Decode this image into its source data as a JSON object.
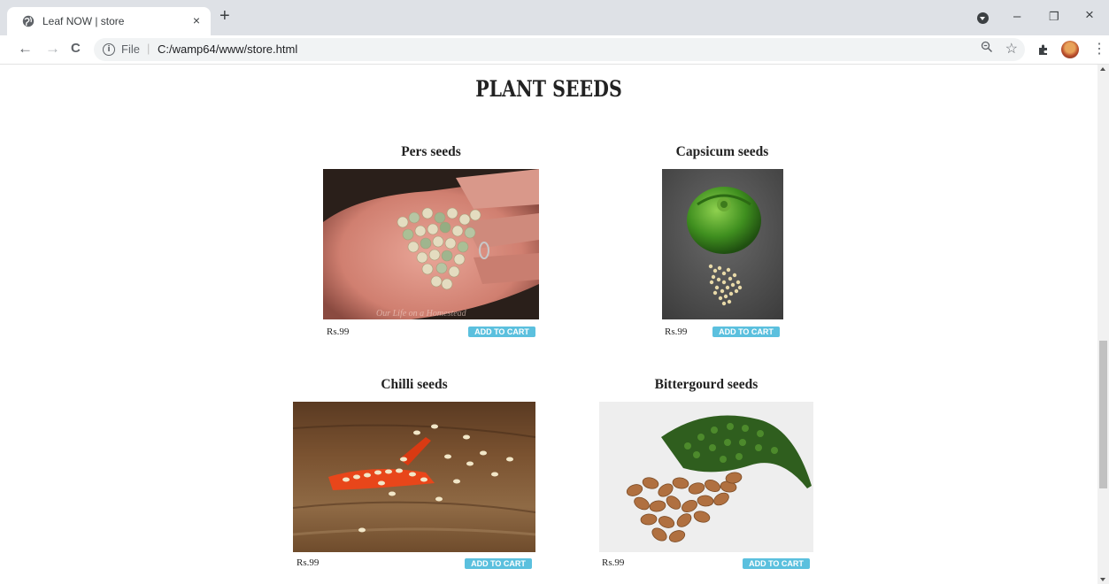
{
  "browser": {
    "tab_title": "Leaf NOW | store",
    "tab_close": "×",
    "new_tab": "+",
    "address_scheme": "File",
    "address_separator": "|",
    "address_url": "C:/wamp64/www/store.html",
    "window_controls": {
      "minimize": "–",
      "maximize": "❐",
      "close": "×"
    },
    "nav": {
      "back": "←",
      "forward": "→",
      "reload": "C"
    },
    "icons": [
      "globe-icon",
      "info-icon",
      "zoom-icon",
      "star-icon",
      "extensions-icon",
      "avatar",
      "menu-icon"
    ]
  },
  "page": {
    "heading": "PLANT SEEDS",
    "products": [
      {
        "name": "Pers seeds",
        "price": "Rs.99",
        "button": "ADD TO CART"
      },
      {
        "name": "Capsicum seeds",
        "price": "Rs.99",
        "button": "ADD TO CART"
      },
      {
        "name": "Chilli seeds",
        "price": "Rs.99",
        "button": "ADD TO CART"
      },
      {
        "name": "Bittergourd seeds",
        "price": "Rs.99",
        "button": "ADD TO CART"
      }
    ]
  },
  "colors": {
    "accent": "#5bc0de",
    "tabstrip": "#dee1e6",
    "omnibox": "#f1f3f4"
  }
}
